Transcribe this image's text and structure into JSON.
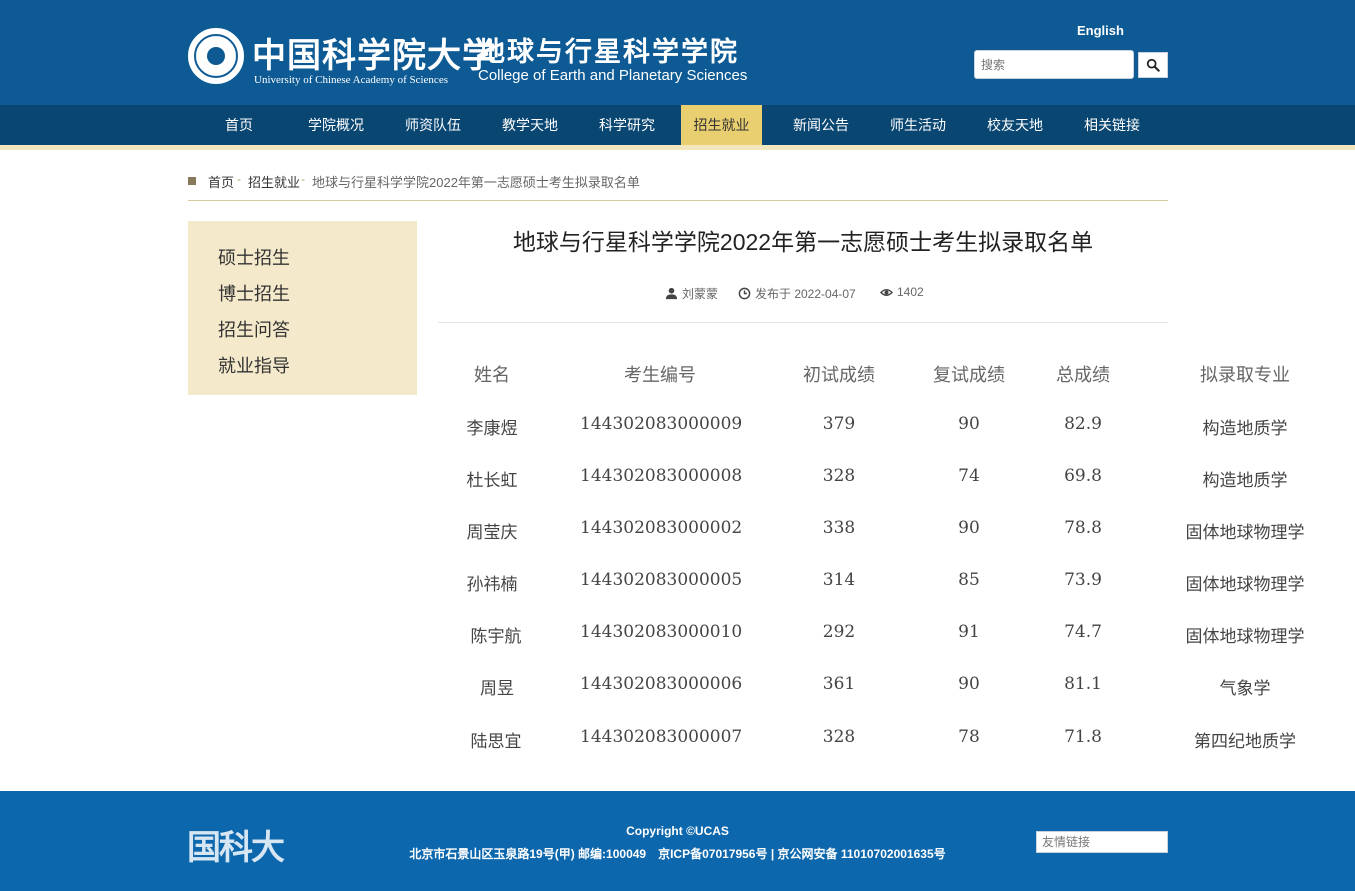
{
  "header": {
    "logo_cn": "中国科学院大学",
    "logo_en": "University of Chinese Academy of Sciences",
    "college_cn": "地球与行星科学学院",
    "college_en": "College of Earth and Planetary Sciences",
    "lang_link": "English",
    "search_placeholder": "搜索",
    "search_icon": "search-icon"
  },
  "nav": {
    "items": [
      "首页",
      "学院概况",
      "师资队伍",
      "教学天地",
      "科学研究",
      "招生就业",
      "新闻公告",
      "师生活动",
      "校友天地",
      "相关链接"
    ],
    "active": "招生就业"
  },
  "breadcrumb": {
    "items": [
      "首页",
      "招生就业"
    ],
    "separator": "-",
    "current": "地球与行星科学学院2022年第一志愿硕士考生拟录取名单"
  },
  "sidebar": {
    "items": [
      "硕士招生",
      "博士招生",
      "招生问答",
      "就业指导"
    ]
  },
  "article": {
    "title": "地球与行星科学学院2022年第一志愿硕士考生拟录取名单",
    "author": "刘蒙蒙",
    "published": "发布于 2022-04-07",
    "views": "1402"
  },
  "table": {
    "headers": [
      "姓名",
      "考生编号",
      "初试成绩",
      "复试成绩",
      "总成绩",
      "拟录取专业"
    ],
    "rows": [
      [
        "李康煜",
        "144302083000009",
        "379",
        "90",
        "82.9",
        "构造地质学"
      ],
      [
        "杜长虹",
        "144302083000008",
        "328",
        "74",
        "69.8",
        "构造地质学"
      ],
      [
        "周莹庆",
        "144302083000002",
        "338",
        "90",
        "78.8",
        "固体地球物理学"
      ],
      [
        "孙祎楠",
        "144302083000005",
        "314",
        "85",
        "73.9",
        "固体地球物理学"
      ],
      [
        "陈宇航",
        "144302083000010",
        "292",
        "91",
        "74.7",
        "固体地球物理学"
      ],
      [
        "周昱",
        "144302083000006",
        "361",
        "90",
        "81.1",
        "气象学"
      ],
      [
        "陆思宜",
        "144302083000007",
        "328",
        "78",
        "71.8",
        "第四纪地质学"
      ]
    ]
  },
  "footer": {
    "logo": "国科大",
    "copyright": "Copyright ©UCAS",
    "address": "北京市石景山区玉泉路19号(甲) 邮编:100049　京ICP备07017956号 | 京公网安备 11010702001635号",
    "friend_links": "友情链接"
  },
  "colors": {
    "header_blue": "#0d5a94",
    "nav_blue": "#0a4672",
    "active_gold": "#e9cf6f",
    "sidebar_bg": "#f5e9cb",
    "footer_blue": "#0d67ad"
  }
}
